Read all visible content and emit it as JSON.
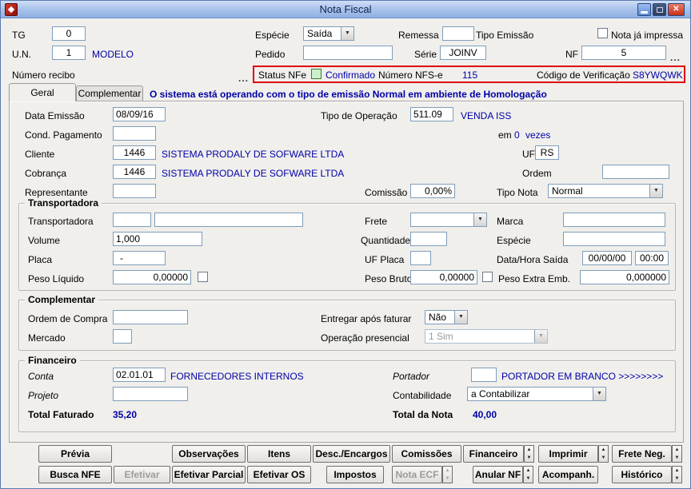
{
  "window": {
    "title": "Nota Fiscal"
  },
  "icons": {
    "close": "✕",
    "dropdown": "▼",
    "spin_up": "▲",
    "spin_down": "▼",
    "ellipsis": "..."
  },
  "colors": {
    "value_text": "#0000A8",
    "status_green": "#C9F0C9",
    "alert_border_red": "#E00505",
    "titlebar_blue": "#9BB9E8"
  },
  "header": {
    "tg": {
      "label": "TG",
      "value": "0"
    },
    "especie": {
      "label": "Espécie",
      "value": "Saída"
    },
    "remessa": {
      "label": "Remessa",
      "value": ""
    },
    "tipo_emissao": {
      "label": "Tipo Emissão"
    },
    "nota_ja_impressa": {
      "label": "Nota já impressa",
      "checked": false
    },
    "un": {
      "label": "U.N.",
      "value": "1",
      "desc": "MODELO"
    },
    "pedido": {
      "label": "Pedido",
      "value": ""
    },
    "serie": {
      "label": "Série",
      "value": "JOINV"
    },
    "nf": {
      "label": "NF",
      "value": "5"
    },
    "numero_recibo": {
      "label": "Número recibo"
    }
  },
  "status_bar": {
    "status_label": "Status NFe",
    "status_value": "Confirmado",
    "nfse_label": "Número NFS-e",
    "nfse_value": "115",
    "verificacao_label": "Código de Verificação",
    "verificacao_value": "S8YWQWK"
  },
  "tabs": {
    "geral": "Geral",
    "complementar": "Complementar",
    "notice": "O sistema está operando com o tipo de emissão Normal em ambiente de Homologação"
  },
  "geral": {
    "data_emissao": {
      "label": "Data Emissão",
      "value": "08/09/16"
    },
    "tipo_operacao": {
      "label": "Tipo de Operação",
      "value": "511.09",
      "desc": "VENDA ISS"
    },
    "cond_pagamento": {
      "label": "Cond. Pagamento",
      "value": ""
    },
    "parcelas": {
      "em": "em",
      "value": "0",
      "vezes": "vezes"
    },
    "cliente": {
      "label": "Cliente",
      "value": "1446",
      "desc": "SISTEMA PRODALY DE SOFWARE LTDA"
    },
    "uf": {
      "label": "UF",
      "value": "RS"
    },
    "cobranca": {
      "label": "Cobrança",
      "value": "1446",
      "desc": "SISTEMA PRODALY DE SOFWARE LTDA"
    },
    "ordem": {
      "label": "Ordem",
      "value": ""
    },
    "representante": {
      "label": "Representante",
      "value": ""
    },
    "comissao": {
      "label": "Comissão",
      "value": "0,00%"
    },
    "tipo_nota": {
      "label": "Tipo Nota",
      "value": "Normal"
    }
  },
  "transportadora": {
    "title": "Transportadora",
    "transportadora": {
      "label": "Transportadora",
      "code": "",
      "name": ""
    },
    "frete": {
      "label": "Frete",
      "value": ""
    },
    "marca": {
      "label": "Marca",
      "value": ""
    },
    "volume": {
      "label": "Volume",
      "value": "1,000"
    },
    "quantidade": {
      "label": "Quantidade",
      "value": ""
    },
    "especie": {
      "label": "Espécie",
      "value": ""
    },
    "placa": {
      "label": "Placa",
      "value": "-"
    },
    "uf_placa": {
      "label": "UF Placa",
      "value": ""
    },
    "data_hora_saida": {
      "label": "Data/Hora Saída",
      "date": "00/00/00",
      "time": "00:00"
    },
    "peso_liquido": {
      "label": "Peso Líquido",
      "value": "0,00000",
      "checked": false
    },
    "peso_bruto": {
      "label": "Peso Bruto",
      "value": "0,00000",
      "checked": false
    },
    "peso_extra": {
      "label": "Peso Extra Emb.",
      "value": "0,000000"
    }
  },
  "complementar_group": {
    "title": "Complementar",
    "ordem_compra": {
      "label": "Ordem de Compra",
      "value": ""
    },
    "entregar_apos_faturar": {
      "label": "Entregar após faturar",
      "value": "Não"
    },
    "mercado": {
      "label": "Mercado",
      "value": ""
    },
    "operacao_presencial": {
      "label": "Operação presencial",
      "value": "1 Sim",
      "disabled": true
    }
  },
  "financeiro_group": {
    "title": "Financeiro",
    "conta": {
      "label": "Conta",
      "value": "02.01.01",
      "desc": "FORNECEDORES INTERNOS"
    },
    "portador": {
      "label": "Portador",
      "value": "",
      "desc": "PORTADOR EM BRANCO >>>>>>>>"
    },
    "projeto": {
      "label": "Projeto",
      "value": ""
    },
    "contabilidade": {
      "label": "Contabilidade",
      "value": "a Contabilizar"
    },
    "total_faturado": {
      "label": "Total Faturado",
      "value": "35,20"
    },
    "total_nota": {
      "label": "Total da Nota",
      "value": "40,00"
    }
  },
  "buttons": {
    "row1": [
      {
        "label": "Prévia"
      },
      {
        "label": "Observações"
      },
      {
        "label": "Itens"
      },
      {
        "label": "Desc./Encargos"
      },
      {
        "label": "Comissões"
      },
      {
        "label": "Financeiro",
        "spinner": true
      },
      {
        "label": "Imprimir",
        "spinner": true
      },
      {
        "label": "Frete Neg.",
        "spinner": true
      }
    ],
    "row2": [
      {
        "label": "Busca NFE"
      },
      {
        "label": "Efetivar",
        "disabled": true
      },
      {
        "label": "Efetivar Parcial"
      },
      {
        "label": "Efetivar OS"
      },
      {
        "label": "Impostos"
      },
      {
        "label": "Nota ECF",
        "disabled": true,
        "spinner": true
      },
      {
        "label": "Anular NF",
        "spinner": true
      },
      {
        "label": "Acompanh."
      },
      {
        "label": "Histórico",
        "spinner": true
      }
    ]
  }
}
